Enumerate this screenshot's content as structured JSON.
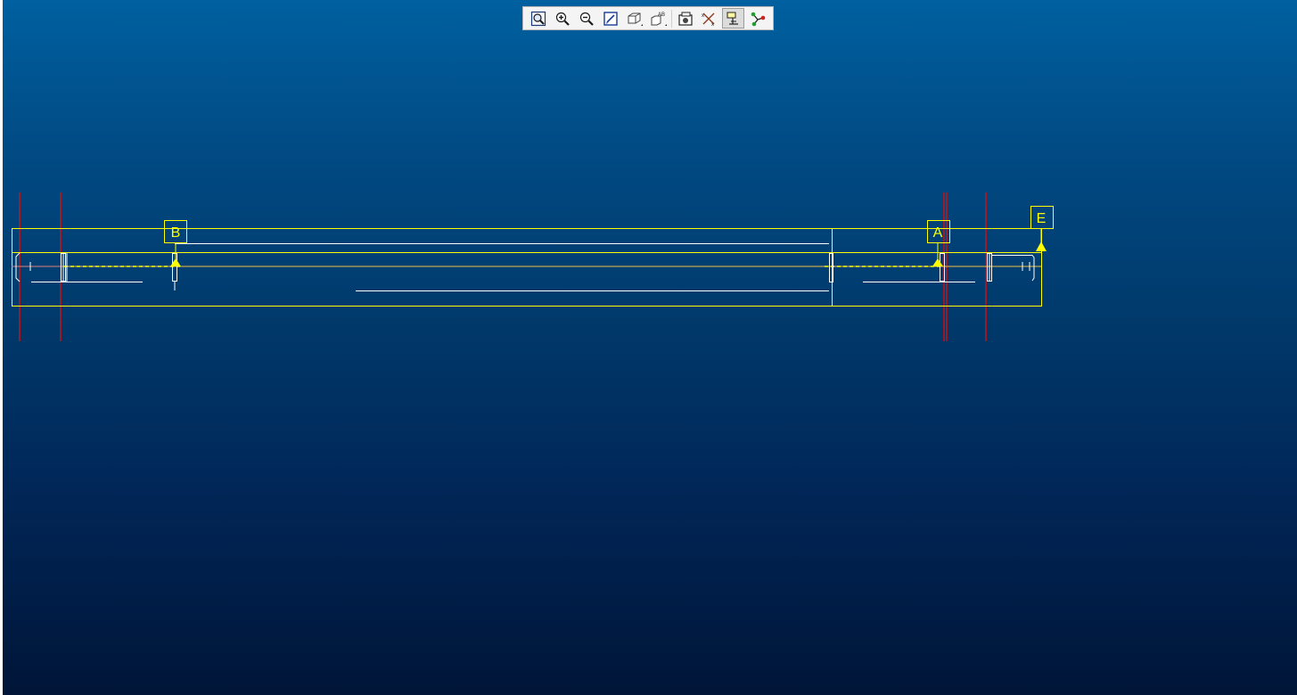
{
  "toolbar": {
    "buttons": [
      {
        "name": "zoom-fit",
        "icon": "zoom-fit-icon"
      },
      {
        "name": "zoom-in",
        "icon": "zoom-in-icon"
      },
      {
        "name": "zoom-out",
        "icon": "zoom-out-icon"
      },
      {
        "name": "repaint",
        "icon": "repaint-icon"
      },
      {
        "name": "view-orientation",
        "icon": "cube-view-icon"
      },
      {
        "name": "saved-views",
        "icon": "saved-views-icon"
      },
      {
        "name": "view-manager",
        "icon": "view-manager-icon"
      },
      {
        "name": "datum-display",
        "icon": "datum-display-icon"
      },
      {
        "name": "annotation-display",
        "icon": "annotation-display-icon"
      },
      {
        "name": "spin-center",
        "icon": "spin-center-icon"
      }
    ]
  },
  "drawing": {
    "labels": {
      "b": "B",
      "a": "A",
      "e": "E"
    },
    "colors": {
      "background_top": "#0060a0",
      "background_bottom": "#001538",
      "annotation": "#ffff00",
      "datum_line": "#cc1010",
      "geometry": "#ffffff"
    }
  }
}
